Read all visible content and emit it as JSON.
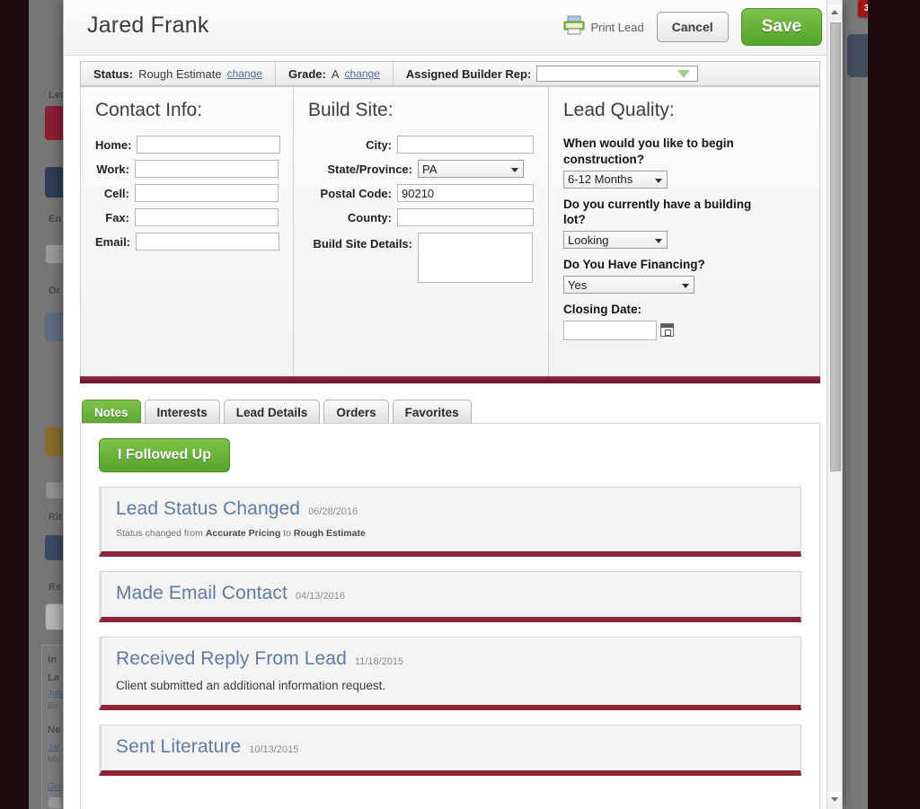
{
  "background": {
    "badge_count": "3",
    "sidebar_labels": [
      "Lea",
      "En",
      "Or",
      "Rit",
      "Re"
    ],
    "info_panel": {
      "heading": "In",
      "rows": [
        {
          "label": "La",
          "link": "Joh",
          "sub": "Bir"
        },
        {
          "label": "Ne",
          "link": "Jar",
          "sub": "Mo"
        },
        {
          "label": "",
          "link": "Gre",
          "sub": ""
        }
      ]
    }
  },
  "modal": {
    "title": "Jared Frank",
    "header": {
      "print_icon": "printer-icon",
      "print_label": "Print Lead",
      "cancel_label": "Cancel",
      "save_label": "Save"
    },
    "status_strip": {
      "status_key": "Status:",
      "status_value": "Rough Estimate",
      "status_change": "change",
      "grade_key": "Grade:",
      "grade_value": "A",
      "grade_change": "change",
      "rep_key": "Assigned Builder Rep:",
      "rep_value": "",
      "rep_placeholder": ""
    },
    "contact_info": {
      "title": "Contact Info:",
      "fields": [
        {
          "label": "Home:",
          "value": ""
        },
        {
          "label": "Work:",
          "value": ""
        },
        {
          "label": "Cell:",
          "value": ""
        },
        {
          "label": "Fax:",
          "value": ""
        },
        {
          "label": "Email:",
          "value": ""
        }
      ]
    },
    "build_site": {
      "title": "Build Site:",
      "city_label": "City:",
      "city_value": "",
      "state_label": "State/Province:",
      "state_value": "PA",
      "postal_label": "Postal Code:",
      "postal_value": "90210",
      "county_label": "County:",
      "county_value": "",
      "details_label": "Build Site Details:",
      "details_value": ""
    },
    "lead_quality": {
      "title": "Lead Quality:",
      "q1_label": "When would you like to begin construction?",
      "q1_value": "6-12 Months",
      "q2_label": "Do you currently have a building lot?",
      "q2_value": "Looking",
      "q3_label": "Do You Have Financing?",
      "q3_value": "Yes",
      "closing_label": "Closing Date:",
      "closing_value": "",
      "calendar_icon": "calendar-icon"
    },
    "tabs": [
      {
        "label": "Notes",
        "active": true
      },
      {
        "label": "Interests",
        "active": false
      },
      {
        "label": "Lead Details",
        "active": false
      },
      {
        "label": "Orders",
        "active": false
      },
      {
        "label": "Favorites",
        "active": false
      }
    ],
    "notes": {
      "followup_label": "I Followed Up",
      "cards": [
        {
          "title": "Lead Status Changed",
          "date": "06/28/2016",
          "body_prefix": "Status changed from ",
          "body_bold1": "Accurate Pricing",
          "body_mid": " to ",
          "body_bold2": "Rough Estimate",
          "body": ""
        },
        {
          "title": "Made Email Contact",
          "date": "04/13/2016",
          "body": ""
        },
        {
          "title": "Received Reply From Lead",
          "date": "11/18/2015",
          "body": "Client submitted an additional information request."
        },
        {
          "title": "Sent Literature",
          "date": "10/13/2015",
          "body": ""
        }
      ]
    }
  },
  "colors": {
    "accent_green": "#5aa830",
    "accent_red": "#8e2437",
    "note_title_blue": "#5c7ba6",
    "link_blue": "#4f6fa8"
  }
}
